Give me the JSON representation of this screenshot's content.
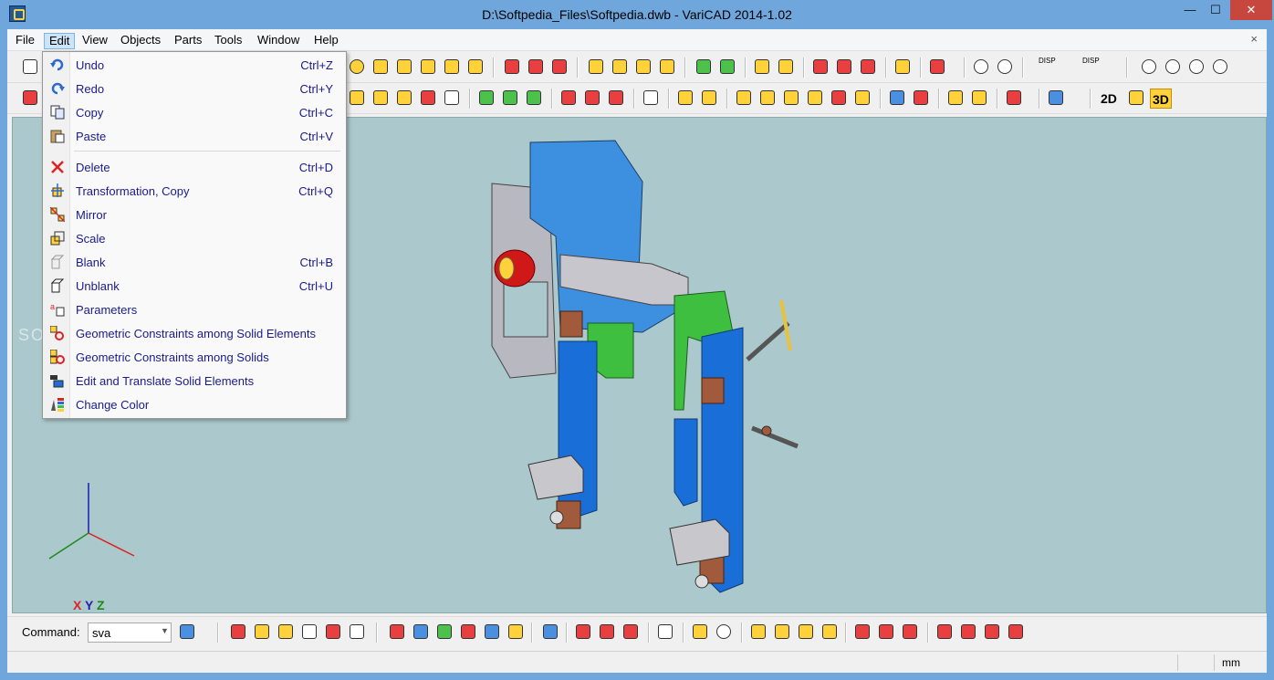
{
  "window": {
    "title": "D:\\Softpedia_Files\\Softpedia.dwb - VariCAD 2014-1.02",
    "minimize": "—",
    "maximize": "☐",
    "close": "✕"
  },
  "menubar": {
    "items": [
      "File",
      "Edit",
      "View",
      "Objects",
      "Parts",
      "Tools",
      "Window",
      "Help"
    ],
    "active": "Edit",
    "mdi_close": "×"
  },
  "edit_menu": {
    "items": [
      {
        "label": "Undo",
        "shortcut": "Ctrl+Z",
        "icon": "undo-icon"
      },
      {
        "label": "Redo",
        "shortcut": "Ctrl+Y",
        "icon": "redo-icon"
      },
      {
        "label": "Copy",
        "shortcut": "Ctrl+C",
        "icon": "copy-icon"
      },
      {
        "label": "Paste",
        "shortcut": "Ctrl+V",
        "icon": "paste-icon"
      },
      {
        "label": "Delete",
        "shortcut": "Ctrl+D",
        "icon": "delete-icon"
      },
      {
        "label": "Transformation, Copy",
        "shortcut": "Ctrl+Q",
        "icon": "transform-icon"
      },
      {
        "label": "Mirror",
        "shortcut": "",
        "icon": "mirror-icon"
      },
      {
        "label": "Scale",
        "shortcut": "",
        "icon": "scale-icon"
      },
      {
        "label": "Blank",
        "shortcut": "Ctrl+B",
        "icon": "blank-icon"
      },
      {
        "label": "Unblank",
        "shortcut": "Ctrl+U",
        "icon": "unblank-icon"
      },
      {
        "label": "Parameters",
        "shortcut": "",
        "icon": "parameters-icon"
      },
      {
        "label": "Geometric Constraints among Solid Elements",
        "shortcut": "",
        "icon": "constraints-elements-icon"
      },
      {
        "label": "Geometric Constraints among Solids",
        "shortcut": "",
        "icon": "constraints-solids-icon"
      },
      {
        "label": "Edit and Translate Solid Elements",
        "shortcut": "",
        "icon": "edit-translate-icon"
      },
      {
        "label": "Change Color",
        "shortcut": "",
        "icon": "change-color-icon"
      }
    ]
  },
  "toolbar": {
    "mode_2d": "2D",
    "mode_3d": "3D",
    "disp1": "DISP",
    "disp2": "DISP"
  },
  "viewport": {
    "axis_x": "X",
    "axis_y": "Y",
    "axis_z": "Z",
    "watermark": "SOFTPEDIA"
  },
  "command": {
    "label": "Command:",
    "value": "sva"
  },
  "status": {
    "units": "mm"
  },
  "colors": {
    "titlebar": "#6fa6dc",
    "viewport": "#abc9cc",
    "menu_text": "#1a1a8c",
    "part_blue": "#3d8fe0",
    "part_green": "#3fbf3f",
    "part_gray": "#b8b8c0"
  }
}
